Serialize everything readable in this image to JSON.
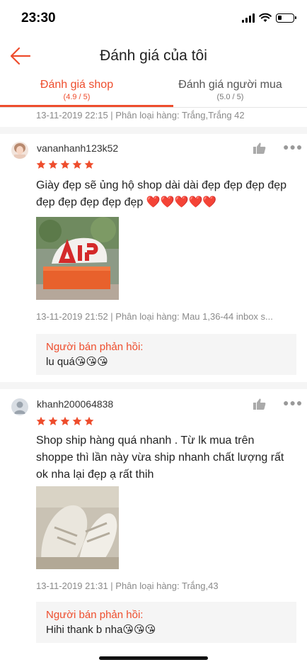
{
  "status_bar": {
    "time": "23:30"
  },
  "header": {
    "title": "Đánh giá của tôi"
  },
  "tabs": [
    {
      "label": "Đánh giá shop",
      "rating": "(4.9 / 5)",
      "active": true
    },
    {
      "label": "Đánh giá người mua",
      "rating": "(5.0 / 5)",
      "active": false
    }
  ],
  "partial_review_meta": "13-11-2019 22:15 | Phân loại hàng: Trắng,Trắng 42",
  "reviews": [
    {
      "username": "vananhanh123k52",
      "stars": 5,
      "text": "Giày đẹp sẽ ủng hộ shop dài dài đẹp đẹp đẹp đẹp đẹp đẹp đẹp đẹp đẹp ❤️❤️❤️❤️❤️",
      "meta": "13-11-2019 21:52 | Phân loại hàng: Mau 1,36-44 inbox s...",
      "reply_label": "Người bán phản hồi:",
      "reply_text": "lu quá😘😘😘"
    },
    {
      "username": "khanh200064838",
      "stars": 5,
      "text": " Shop ship hàng quá nhanh . Từ lk mua trên shoppe thì lần này vừa ship nhanh chất lượng rất ok nha  lại đẹp ạ  rất thih",
      "meta": "13-11-2019 21:31 | Phân loại hàng: Trắng,43",
      "reply_label": "Người bán phản hồi:",
      "reply_text": "Hihi thank b nha😘😘😘"
    }
  ],
  "colors": {
    "accent": "#ee4d2d",
    "star": "#ee4d2d",
    "reply_bg": "#f5f5f5",
    "separator": "#f5f5f5"
  },
  "icons": {
    "back": "arrow-left-icon",
    "like": "thumbs-up-icon",
    "more": "ellipsis-icon",
    "star": "star-icon"
  }
}
